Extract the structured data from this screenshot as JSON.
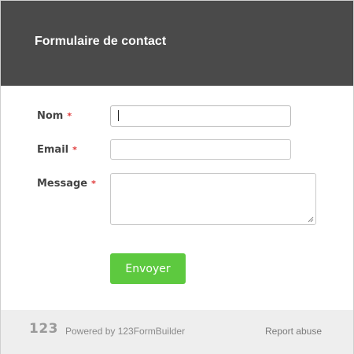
{
  "header": {
    "title": "Formulaire de contact"
  },
  "form": {
    "required_mark": "*",
    "fields": [
      {
        "label": "Nom",
        "value": "",
        "type": "text"
      },
      {
        "label": "Email",
        "value": "",
        "type": "text"
      },
      {
        "label": "Message",
        "value": "",
        "type": "textarea"
      }
    ],
    "submit_label": "Envoyer"
  },
  "footer": {
    "logo_text": "123",
    "powered_text": "Powered by 123FormBuilder",
    "report_label": "Report abuse"
  },
  "colors": {
    "header_bg": "#4a4a4a",
    "submit_bg": "#5dc93f",
    "required": "#e03b3b",
    "footer_bg": "#eeeeee"
  }
}
